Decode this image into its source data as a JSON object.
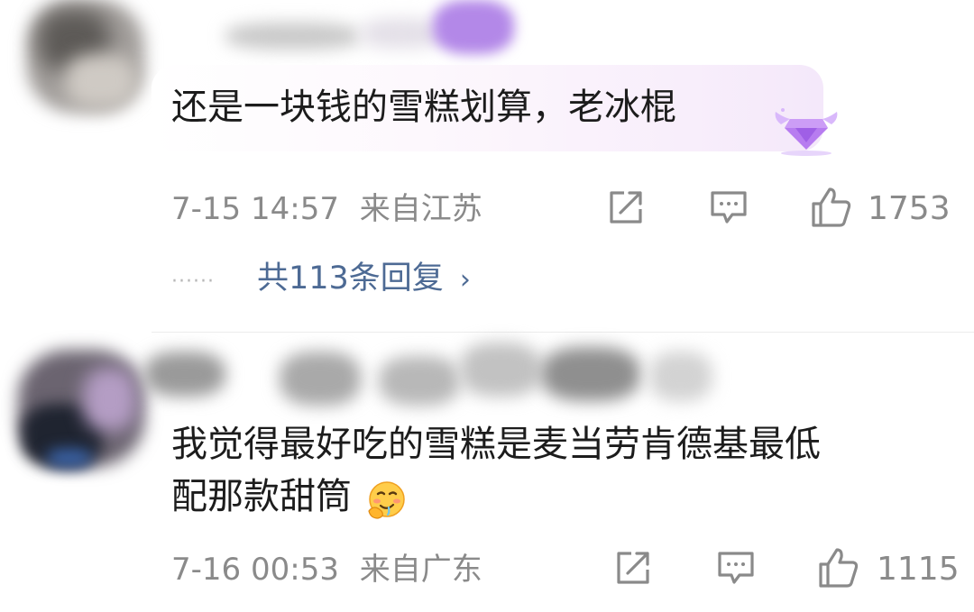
{
  "comments": [
    {
      "text": "还是一块钱的雪糕划算，老冰棍",
      "time": "7-15 14:57",
      "location": "来自江苏",
      "likes": "1753",
      "reply_summary": "共113条回复",
      "badge_icon": "diamond-wing-badge-icon",
      "actions": [
        "share-icon",
        "comment-icon",
        "like-icon"
      ]
    },
    {
      "text_line1": "我觉得最好吃的雪糕是麦当劳肯德基最低",
      "text_line2": "配那款甜筒",
      "emoji_icon": "drooling-face-emoji-icon",
      "time": "7-16 00:53",
      "location": "来自广东",
      "likes": "1115",
      "actions": [
        "share-icon",
        "comment-icon",
        "like-icon"
      ]
    }
  ],
  "colors": {
    "text": "#1c1c1c",
    "meta": "#8a8a8a",
    "reply_link": "#4d6a94",
    "bubble_tint": "#f4e8fa",
    "badge": "#b77cf0"
  }
}
